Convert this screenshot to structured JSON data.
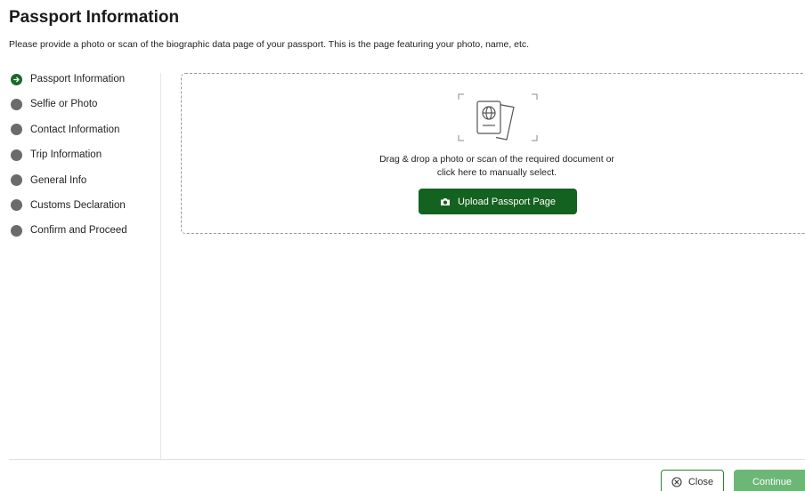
{
  "header": {
    "title": "Passport Information",
    "subtitle": "Please provide a photo or scan of the biographic data page of your passport. This is the page featuring your photo, name, etc."
  },
  "steps": [
    {
      "label": "Passport Information",
      "state": "active"
    },
    {
      "label": "Selfie or Photo",
      "state": "pending"
    },
    {
      "label": "Contact Information",
      "state": "pending"
    },
    {
      "label": "Trip Information",
      "state": "pending"
    },
    {
      "label": "General Info",
      "state": "pending"
    },
    {
      "label": "Customs Declaration",
      "state": "pending"
    },
    {
      "label": "Confirm and Proceed",
      "state": "pending"
    }
  ],
  "upload": {
    "instruction_line1": "Drag & drop a photo or scan of the required document or",
    "instruction_line2": "click here to manually select.",
    "button_label": "Upload Passport Page",
    "icon": "passport-icon",
    "button_icon": "camera-icon"
  },
  "footer": {
    "close_label": "Close",
    "close_icon": "close-circle-icon",
    "continue_label": "Continue"
  },
  "colors": {
    "primary_green": "#14621f",
    "active_step": "#1a6b2b",
    "pending_step": "#6b6b6b",
    "continue_disabled": "#6cb776"
  }
}
